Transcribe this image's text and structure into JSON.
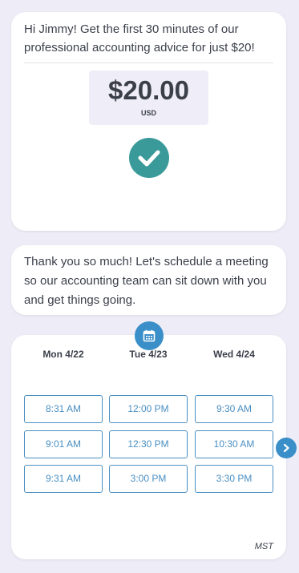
{
  "offer": {
    "message": "Hi Jimmy! Get the first 30 minutes of our professional accounting advice for just $20!",
    "price": "$20.00",
    "currency": "USD",
    "status_icon": "check-circle-icon"
  },
  "thanks": {
    "message": "Thank you so much! Let's schedule a meeting so our accounting team can sit down with you and get things going."
  },
  "schedule": {
    "badge_icon": "calendar-icon",
    "days": [
      {
        "label": "Mon 4/22",
        "slots": [
          "8:31 AM",
          "9:01 AM",
          "9:31 AM"
        ]
      },
      {
        "label": "Tue 4/23",
        "slots": [
          "12:00 PM",
          "12:30 PM",
          "3:00 PM"
        ]
      },
      {
        "label": "Wed 4/24",
        "slots": [
          "9:30 AM",
          "10:30 AM",
          "3:30 PM"
        ]
      }
    ],
    "timezone": "MST",
    "next_icon": "chevron-right-icon"
  },
  "colors": {
    "background": "#eeedf7",
    "check_teal": "#3a9a9a",
    "accent_blue": "#3b8fc9",
    "slot_border": "#4a8fc2"
  }
}
